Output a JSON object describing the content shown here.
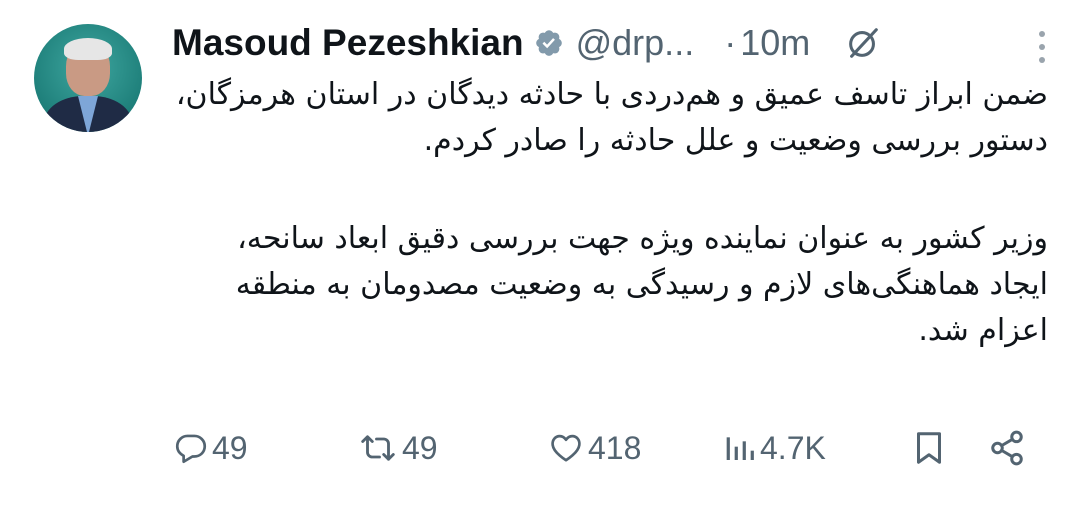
{
  "author": {
    "name": "Masoud Pezeshkian",
    "handle": "@drp...",
    "separator": "·",
    "time": "10m",
    "verified_color": "#829aab"
  },
  "tweet": {
    "paragraphs": [
      "ضمن ابراز تاسف عمیق و هم‌دردی با حادثه دیدگان در استان هرمزگان، دستور بررسی وضعیت و علل حادثه را صادر کردم.",
      "وزیر کشور به عنوان نماینده ویژه جهت بررسی دقیق ابعاد سانحه، ایجاد هماهنگی‌های لازم و رسیدگی به وضعیت مصدومان به منطقه اعزام شد."
    ]
  },
  "stats": {
    "replies": "49",
    "reposts": "49",
    "likes": "418",
    "views": "4.7K"
  },
  "icons": [
    "avatar",
    "verified-badge-icon",
    "grok-icon",
    "more-icon",
    "reply-icon",
    "repost-icon",
    "like-icon",
    "views-icon",
    "bookmark-icon",
    "share-icon"
  ],
  "colors": {
    "text": "#0f1419",
    "secondary": "#536471"
  }
}
